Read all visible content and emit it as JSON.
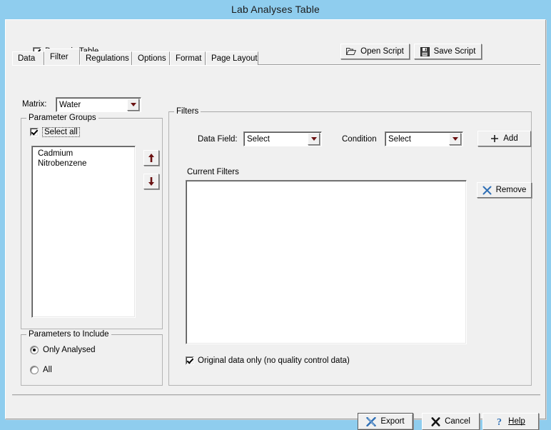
{
  "window": {
    "title": "Lab Analyses Table"
  },
  "toolbar": {
    "dynamic_table_label": "Dynamic Table",
    "dynamic_table_checked": true,
    "open_script_label": "Open Script",
    "save_script_label": "Save Script"
  },
  "tabs": [
    {
      "label": "Data",
      "active": false
    },
    {
      "label": "Filter",
      "active": true
    },
    {
      "label": "Regulations",
      "active": false
    },
    {
      "label": "Options",
      "active": false
    },
    {
      "label": "Format",
      "active": false
    },
    {
      "label": "Page Layout",
      "active": false
    }
  ],
  "matrix": {
    "label": "Matrix:",
    "value": "Water"
  },
  "parameter_groups": {
    "legend": "Parameter Groups",
    "select_all_label": "Select all",
    "select_all_checked": true,
    "items": [
      {
        "label": "Cadmium",
        "checked": true
      },
      {
        "label": "Nitrobenzene",
        "checked": true
      }
    ],
    "move_up_icon": "arrow-up-icon",
    "move_down_icon": "arrow-down-icon"
  },
  "parameters_to_include": {
    "legend": "Parameters to Include",
    "options": [
      {
        "label": "Only Analysed",
        "selected": true
      },
      {
        "label": "All",
        "selected": false
      }
    ]
  },
  "filters": {
    "legend": "Filters",
    "data_field_label": "Data Field:",
    "data_field_value": "Select",
    "condition_label": "Condition",
    "condition_value": "Select",
    "add_label": "Add",
    "current_filters_label": "Current Filters",
    "current_filters_items": [],
    "remove_label": "Remove",
    "original_data_only_label": "Original data only (no quality control data)",
    "original_data_only_checked": true
  },
  "footer": {
    "export_label": "Export",
    "cancel_label": "Cancel",
    "help_label": "Help"
  },
  "colors": {
    "desktop": "#8fcdee",
    "dialog": "#f0f0f0",
    "arrow_red": "#6b1212",
    "icon_blue": "#2f6fb5"
  }
}
